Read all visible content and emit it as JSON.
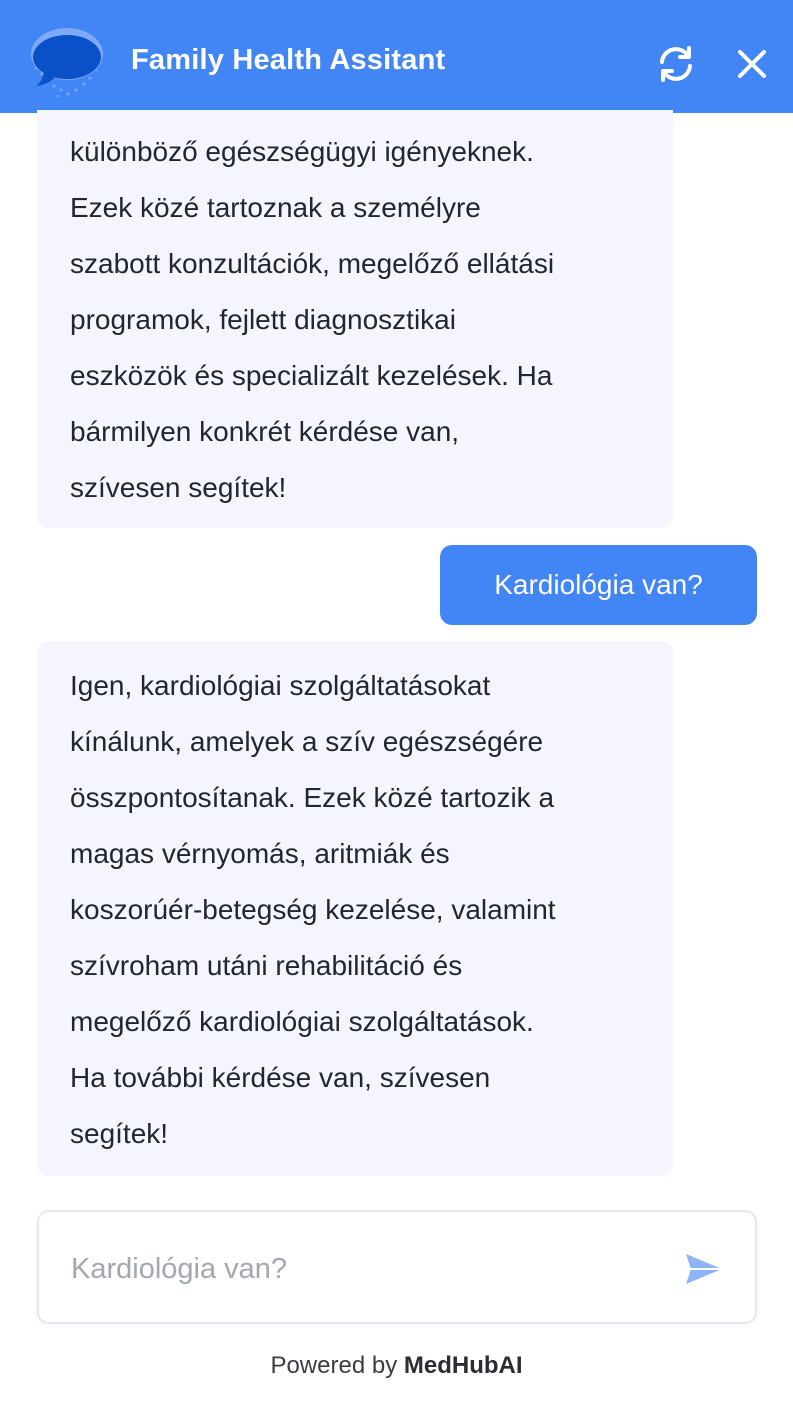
{
  "header": {
    "title": "Family Health Assitant",
    "logo_icon": "chat-bubble-logo-icon",
    "refresh_icon": "refresh-icon",
    "close_icon": "close-icon",
    "background_color": "#4285f4"
  },
  "messages": [
    {
      "role": "assistant",
      "lines": [
        "különböző egészségügyi igényeknek.",
        "Ezek közé tartoznak a személyre",
        "szabott konzultációk, megelőző ellátási",
        "programok, fejlett diagnosztikai",
        "eszközök és specializált kezelések. Ha",
        "bármilyen konkrét kérdése van,",
        "szívesen segítek!"
      ]
    },
    {
      "role": "user",
      "text": "Kardiológia van?"
    },
    {
      "role": "assistant",
      "lines": [
        "Igen, kardiológiai szolgáltatásokat",
        "kínálunk, amelyek a szív egészségére",
        "összpontosítanak. Ezek közé tartozik a",
        "magas vérnyomás, aritmiák és",
        "koszorúér-betegség kezelése, valamint",
        "szívroham utáni rehabilitáció és",
        "megelőző kardiológiai szolgáltatások.",
        "Ha további kérdése van, szívesen",
        "segítek!"
      ]
    }
  ],
  "composer": {
    "placeholder": "Kardiológia van?",
    "value": "",
    "send_icon": "send-icon"
  },
  "footer": {
    "prefix": "Powered by",
    "brand": "MedHubAI"
  },
  "colors": {
    "accent": "#4285f4",
    "bot_bubble": "#f4f5fe"
  }
}
